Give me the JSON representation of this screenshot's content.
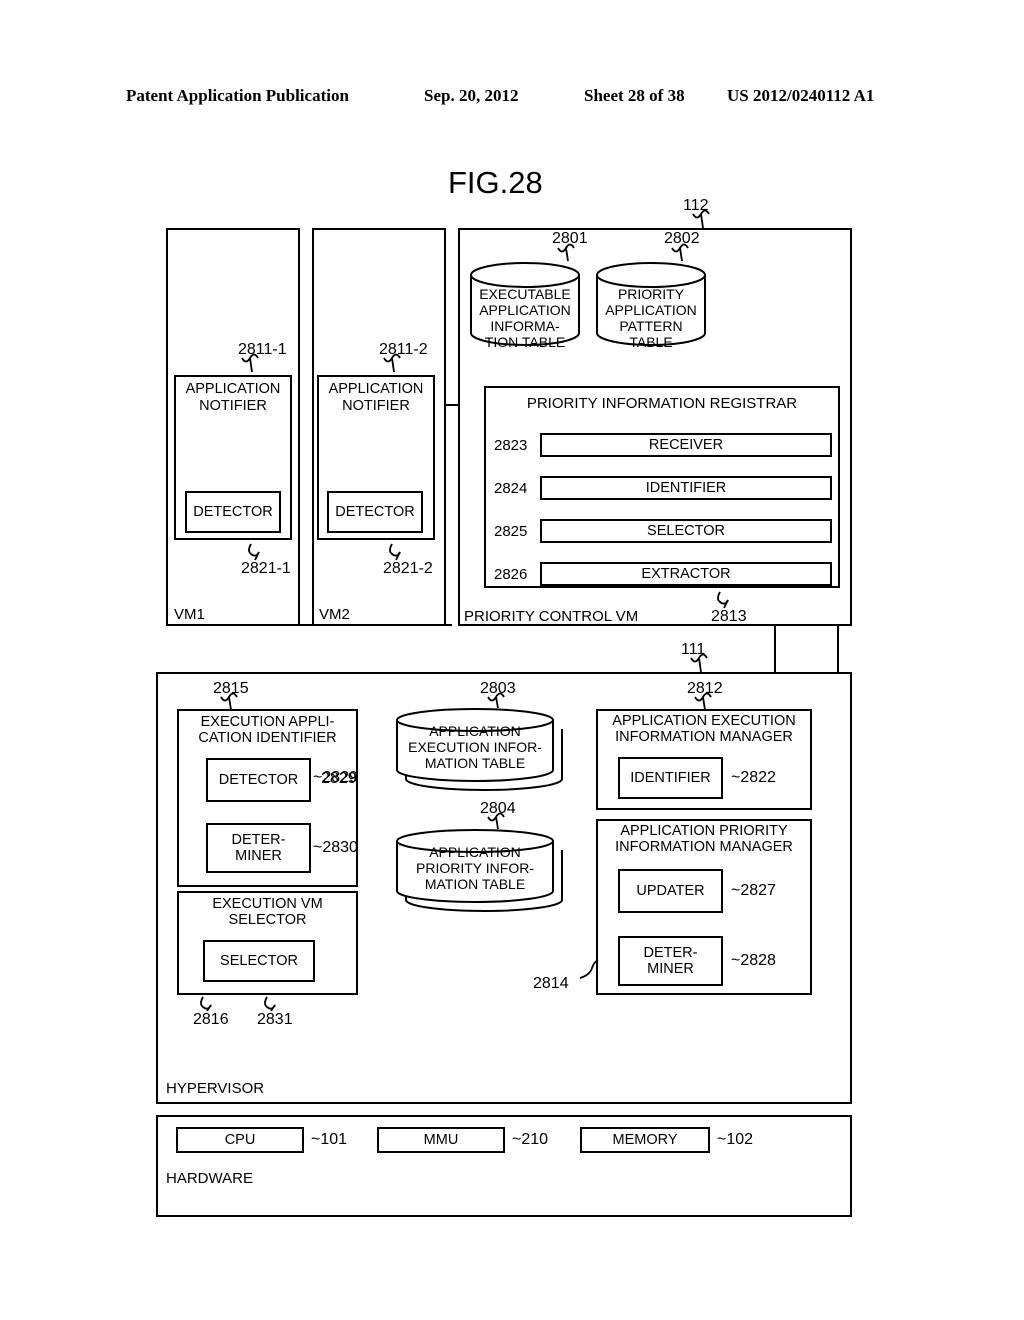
{
  "header": {
    "publication": "Patent Application Publication",
    "date": "Sep. 20, 2012",
    "sheet": "Sheet 28 of 38",
    "number": "US 2012/0240112 A1"
  },
  "figure": {
    "title": "FIG.28"
  },
  "vm1": {
    "caption": "VM1",
    "notifier": {
      "label": "APPLICATION\nNOTIFIER",
      "ref": "2811-1"
    },
    "detector": {
      "label": "DETECTOR",
      "ref": "2821-1"
    }
  },
  "vm2": {
    "caption": "VM2",
    "notifier": {
      "label": "APPLICATION\nNOTIFIER",
      "ref": "2811-2"
    },
    "detector": {
      "label": "DETECTOR",
      "ref": "2821-2"
    }
  },
  "priority_control_vm": {
    "caption": "PRIORITY CONTROL VM",
    "ref": "112",
    "tables": [
      {
        "label": "EXECUTABLE\nAPPLICATION\nINFORMA-\nTION TABLE",
        "ref": "2801"
      },
      {
        "label": "PRIORITY\nAPPLICATION\nPATTERN\nTABLE",
        "ref": "2802"
      }
    ],
    "registrar": {
      "title": "PRIORITY INFORMATION REGISTRAR",
      "ref": "2813",
      "items": [
        {
          "label": "RECEIVER",
          "ref": "2823"
        },
        {
          "label": "IDENTIFIER",
          "ref": "2824"
        },
        {
          "label": "SELECTOR",
          "ref": "2825"
        },
        {
          "label": "EXTRACTOR",
          "ref": "2826"
        }
      ]
    }
  },
  "hypervisor": {
    "caption": "HYPERVISOR",
    "ref": "111",
    "execution_application_identifier": {
      "title": "EXECUTION APPLI-\nCATION IDENTIFIER",
      "ref": "2815",
      "detector": {
        "label": "DETECTOR",
        "ref": "2829"
      },
      "determiner": {
        "label": "DETER-\nMINER",
        "ref": "2830"
      }
    },
    "execution_vm_selector": {
      "title": "EXECUTION VM\nSELECTOR",
      "ref": "2816",
      "selector": {
        "label": "SELECTOR",
        "ref": "2831"
      }
    },
    "tables": [
      {
        "label": "APPLICATION\nEXECUTION INFOR-\nMATION TABLE",
        "ref": "2803"
      },
      {
        "label": "APPLICATION\nPRIORITY INFOR-\nMATION TABLE",
        "ref": "2804"
      }
    ],
    "application_execution_information_manager": {
      "title": "APPLICATION EXECUTION\nINFORMATION MANAGER",
      "ref": "2812",
      "identifier": {
        "label": "IDENTIFIER",
        "ref": "2822"
      }
    },
    "application_priority_information_manager": {
      "title": "APPLICATION PRIORITY\nINFORMATION MANAGER",
      "ref": "2814",
      "updater": {
        "label": "UPDATER",
        "ref": "2827"
      },
      "determiner": {
        "label": "DETER-\nMINER",
        "ref": "2828"
      }
    }
  },
  "hardware": {
    "caption": "HARDWARE",
    "items": [
      {
        "label": "CPU",
        "ref": "101"
      },
      {
        "label": "MMU",
        "ref": "210"
      },
      {
        "label": "MEMORY",
        "ref": "102"
      }
    ]
  }
}
